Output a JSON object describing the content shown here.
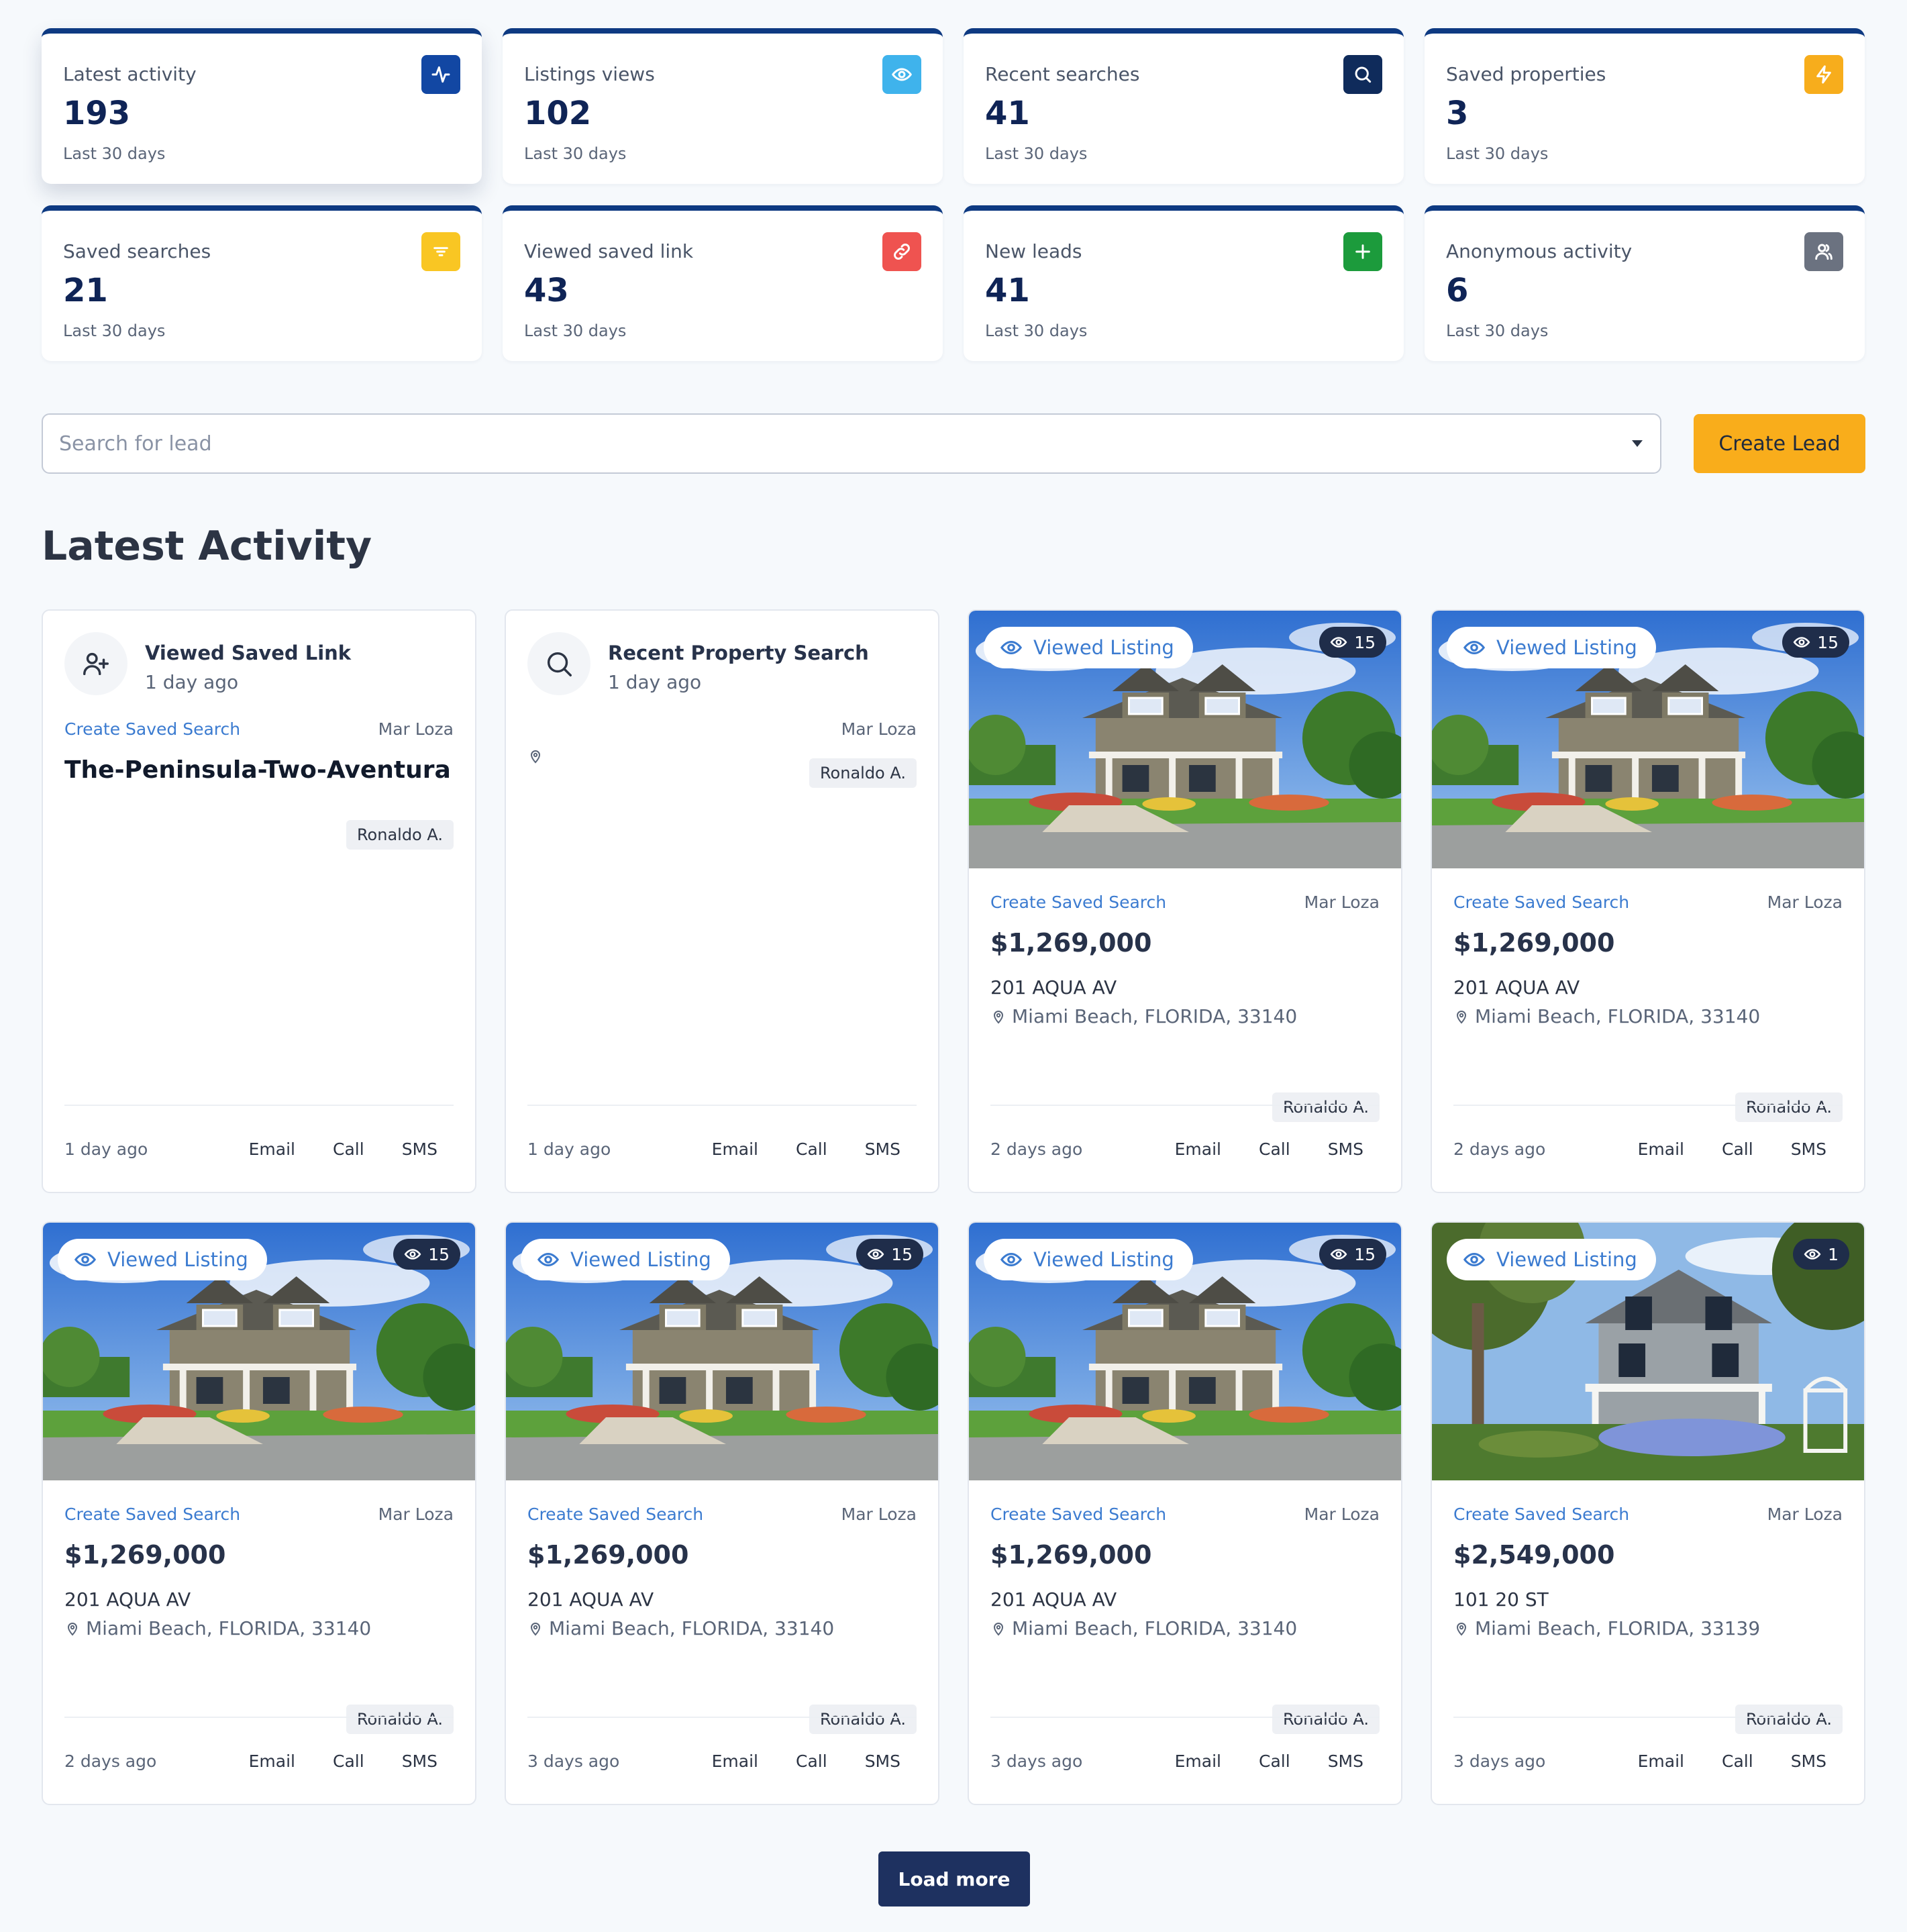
{
  "stats": [
    {
      "label": "Latest activity",
      "value": "193",
      "sub": "Last 30 days",
      "icon": "activity-icon",
      "color": "#1247a3"
    },
    {
      "label": "Listings views",
      "value": "102",
      "sub": "Last 30 days",
      "icon": "eye-icon",
      "color": "#3fb3ec"
    },
    {
      "label": "Recent searches",
      "value": "41",
      "sub": "Last 30 days",
      "icon": "search-icon",
      "color": "#0f2b5b"
    },
    {
      "label": "Saved properties",
      "value": "3",
      "sub": "Last 30 days",
      "icon": "bolt-icon",
      "color": "#f7ad1c"
    },
    {
      "label": "Saved searches",
      "value": "21",
      "sub": "Last 30 days",
      "icon": "filter-icon",
      "color": "#f9c623"
    },
    {
      "label": "Viewed saved link",
      "value": "43",
      "sub": "Last 30 days",
      "icon": "link-icon",
      "color": "#ef5350"
    },
    {
      "label": "New leads",
      "value": "41",
      "sub": "Last 30 days",
      "icon": "plus-icon",
      "color": "#1c9b3c"
    },
    {
      "label": "Anonymous activity",
      "value": "6",
      "sub": "Last 30 days",
      "icon": "users-icon",
      "color": "#6b7280"
    }
  ],
  "search": {
    "placeholder": "Search for lead",
    "create_label": "Create Lead"
  },
  "section_title": "Latest Activity",
  "activity": {
    "saved_link": {
      "title": "Viewed Saved Link",
      "when": "1 day ago",
      "link": "Create Saved Search",
      "agent": "Mar Loza",
      "name": "The-Peninsula-Two-Aventura",
      "tag": "Ronaldo A.",
      "ago": "1 day ago"
    },
    "search": {
      "title": "Recent Property Search",
      "when": "1 day ago",
      "agent": "Mar Loza",
      "tag": "Ronaldo A.",
      "ago": "1 day ago"
    },
    "listings": [
      {
        "views": "15",
        "price": "$1,269,000",
        "address": "201 AQUA AV",
        "city": "Miami Beach, FLORIDA, 33140",
        "ago": "2 days ago",
        "house": "craftsman"
      },
      {
        "views": "15",
        "price": "$1,269,000",
        "address": "201 AQUA AV",
        "city": "Miami Beach, FLORIDA, 33140",
        "ago": "2 days ago",
        "house": "craftsman"
      },
      {
        "views": "15",
        "price": "$1,269,000",
        "address": "201 AQUA AV",
        "city": "Miami Beach, FLORIDA, 33140",
        "ago": "2 days ago",
        "house": "craftsman"
      },
      {
        "views": "15",
        "price": "$1,269,000",
        "address": "201 AQUA AV",
        "city": "Miami Beach, FLORIDA, 33140",
        "ago": "3 days ago",
        "house": "craftsman"
      },
      {
        "views": "15",
        "price": "$1,269,000",
        "address": "201 AQUA AV",
        "city": "Miami Beach, FLORIDA, 33140",
        "ago": "3 days ago",
        "house": "craftsman"
      },
      {
        "views": "1",
        "price": "$2,549,000",
        "address": "101 20 ST",
        "city": "Miami Beach, FLORIDA, 33139",
        "ago": "3 days ago",
        "house": "cottage"
      }
    ],
    "pill_label": "Viewed Listing",
    "link_label": "Create Saved Search",
    "agent": "Mar Loza",
    "tag": "Ronaldo A.",
    "actions": {
      "email": "Email",
      "call": "Call",
      "sms": "SMS"
    }
  },
  "load_more": "Load more"
}
